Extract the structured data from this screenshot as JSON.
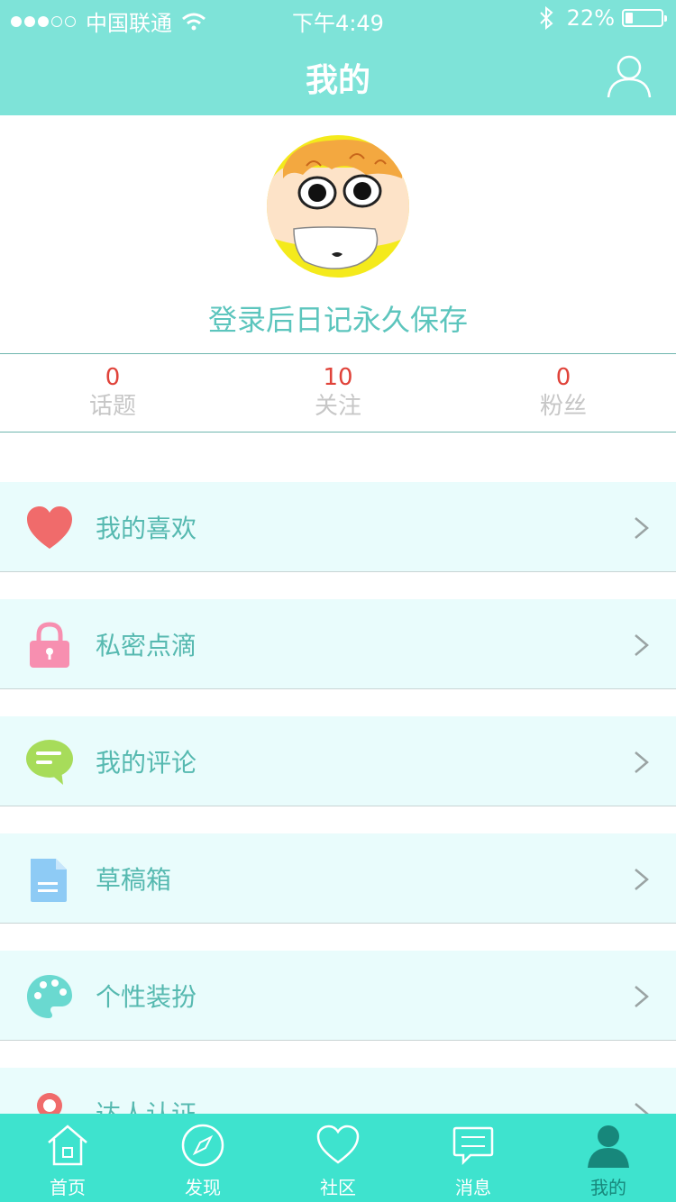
{
  "status_bar": {
    "carrier": "中国联通",
    "time": "下午4:49",
    "battery": "22%",
    "battery_level": 0.22,
    "signal_bars_filled": 3,
    "signal_bars_total": 5
  },
  "nav": {
    "title": "我的",
    "profile_icon": "user-outline-icon"
  },
  "profile": {
    "login_hint": "登录后日记永久保存"
  },
  "stats": [
    {
      "count": "0",
      "label": "话题"
    },
    {
      "count": "10",
      "label": "关注"
    },
    {
      "count": "0",
      "label": "粉丝"
    }
  ],
  "menu": [
    {
      "label": "我的喜欢",
      "icon": "heart-icon",
      "color": "#f06b6b"
    },
    {
      "label": "私密点滴",
      "icon": "lock-icon",
      "color": "#f78fb0"
    },
    {
      "label": "我的评论",
      "icon": "comment-icon",
      "color": "#a7dc5a"
    },
    {
      "label": "草稿箱",
      "icon": "document-icon",
      "color": "#8ecbf5"
    },
    {
      "label": "个性装扮",
      "icon": "palette-icon",
      "color": "#6ad9d0"
    },
    {
      "label": "达人认证",
      "icon": "badge-icon",
      "color": "#f06b6b"
    }
  ],
  "tabbar": [
    {
      "label": "首页",
      "icon": "home-icon"
    },
    {
      "label": "发现",
      "icon": "compass-icon"
    },
    {
      "label": "社区",
      "icon": "heart-outline-icon"
    },
    {
      "label": "消息",
      "icon": "message-icon"
    },
    {
      "label": "我的",
      "icon": "user-icon",
      "active": true
    }
  ],
  "colors": {
    "accent": "#7ee3d8",
    "tabbar": "#3ee3ce",
    "active_tab": "#17877b",
    "count": "#e0433a",
    "text_teal": "#56b9b0"
  }
}
